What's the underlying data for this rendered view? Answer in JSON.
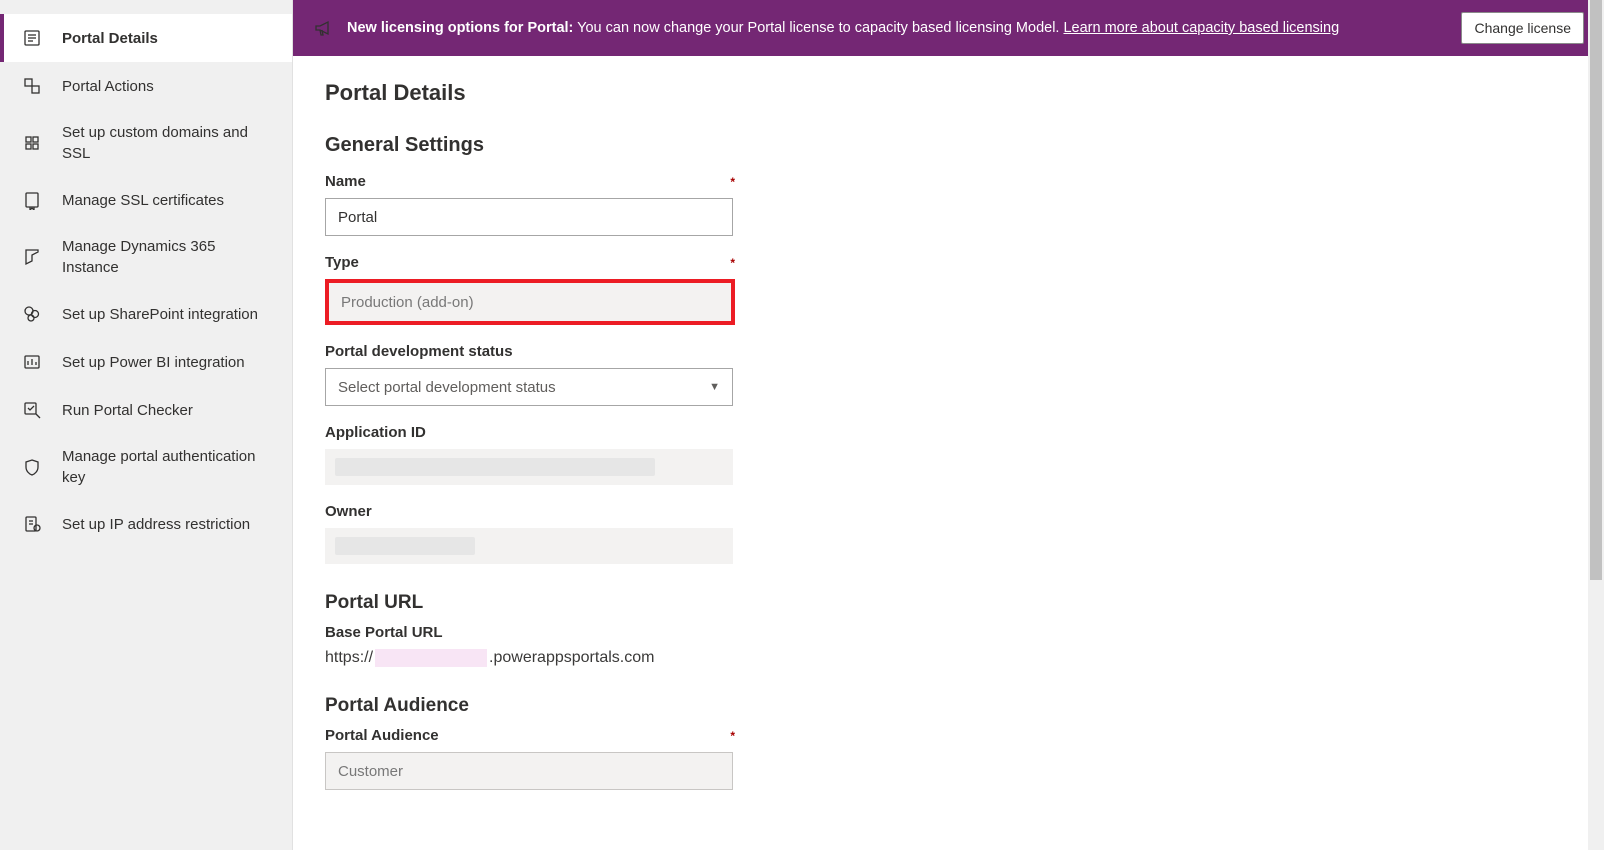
{
  "banner": {
    "bold": "New licensing options for Portal:",
    "text": " You can now change your Portal license to capacity based licensing Model. ",
    "link": "Learn more about capacity based licensing",
    "button": "Change license"
  },
  "sidebar": {
    "items": [
      {
        "label": "Portal Details"
      },
      {
        "label": "Portal Actions"
      },
      {
        "label": "Set up custom domains and SSL"
      },
      {
        "label": "Manage SSL certificates"
      },
      {
        "label": "Manage Dynamics 365 Instance"
      },
      {
        "label": "Set up SharePoint integration"
      },
      {
        "label": "Set up Power BI integration"
      },
      {
        "label": "Run Portal Checker"
      },
      {
        "label": "Manage portal authentication key"
      },
      {
        "label": "Set up IP address restriction"
      }
    ]
  },
  "page": {
    "title": "Portal Details",
    "general_settings": "General Settings",
    "name_label": "Name",
    "name_value": "Portal",
    "type_label": "Type",
    "type_value": "Production (add-on)",
    "status_label": "Portal development status",
    "status_placeholder": "Select portal development status",
    "appid_label": "Application ID",
    "owner_label": "Owner",
    "portal_url_title": "Portal URL",
    "base_url_label": "Base Portal URL",
    "base_url_prefix": "https://",
    "base_url_suffix": ".powerappsportals.com",
    "audience_title": "Portal Audience",
    "audience_label": "Portal Audience",
    "audience_value": "Customer",
    "required_mark": "*"
  }
}
